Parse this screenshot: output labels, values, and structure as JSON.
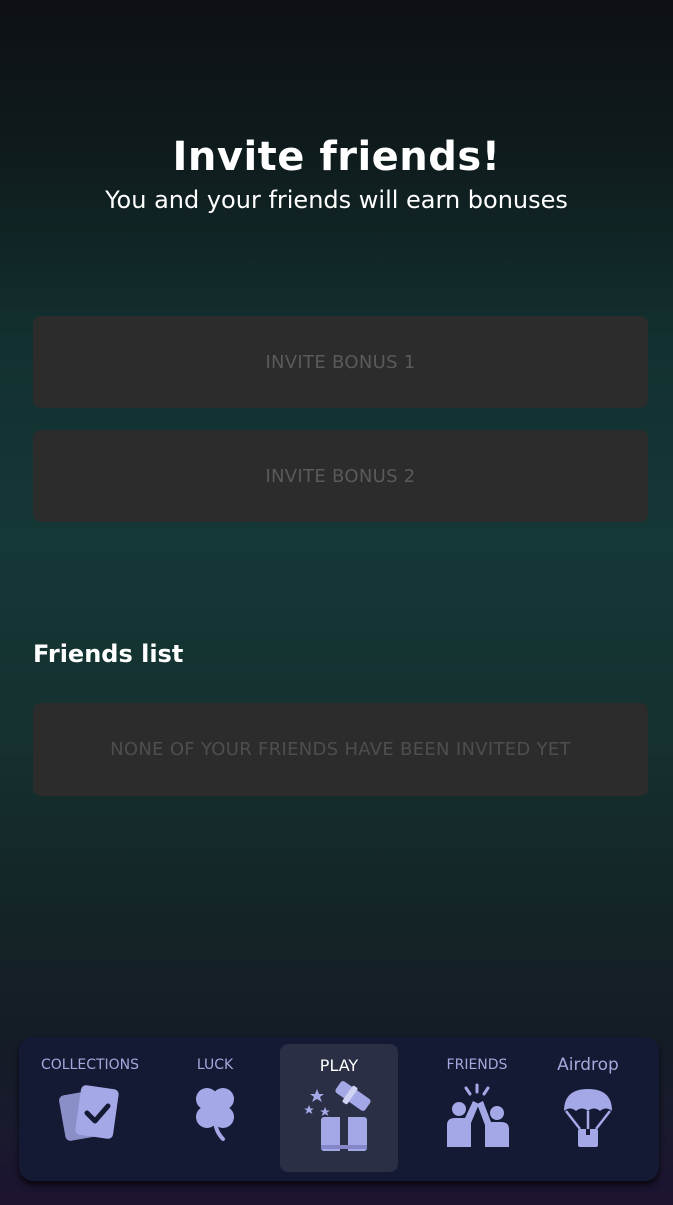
{
  "header": {
    "title": "Invite friends!",
    "subtitle": "You and your friends will earn bonuses"
  },
  "bonuses": [
    {
      "label": "INVITE BONUS 1"
    },
    {
      "label": "INVITE BONUS 2"
    }
  ],
  "friends": {
    "section_title": "Friends list",
    "empty_message": "NONE OF YOUR FRIENDS HAVE BEEN INVITED YET"
  },
  "nav": {
    "items": [
      {
        "label": "COLLECTIONS",
        "icon": "cards-check-icon"
      },
      {
        "label": "LUCK",
        "icon": "clover-icon"
      },
      {
        "label": "PLAY",
        "icon": "gift-icon",
        "active": true
      },
      {
        "label": "FRIENDS",
        "icon": "high-five-icon"
      },
      {
        "label": "Airdrop",
        "icon": "parachute-icon"
      }
    ]
  },
  "colors": {
    "accent_icon": "#a4a8e6",
    "nav_bg": "#141a33",
    "card_bg": "#2c2c2c",
    "muted_text": "#5a5a5a"
  }
}
